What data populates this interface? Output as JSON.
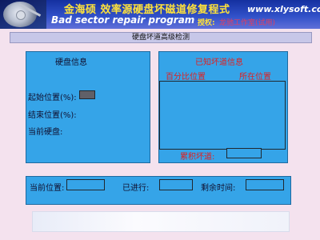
{
  "header": {
    "title": "金海硕 效率源硬盘坏磁道修复程式",
    "subtitle": "Bad sector repair program",
    "website": "www.xlysoft.com",
    "license_label": "授权:",
    "license_value": "龙驰工作室(试用)"
  },
  "window": {
    "title": "硬盘坏道高级检测"
  },
  "disk_info": {
    "heading": "硬盘信息",
    "start_label": "起始位置(%):",
    "end_label": "结束位置(%):",
    "current_disk_label": "当前硬盘:"
  },
  "bad_sectors": {
    "heading": "已知坏道信息",
    "col_percent": "百分比位置",
    "col_location": "所在位置",
    "total_label": "累积坏道:"
  },
  "progress": {
    "current_label": "当前位置:",
    "elapsed_label": "已进行:",
    "remaining_label": "剩余时间:"
  }
}
